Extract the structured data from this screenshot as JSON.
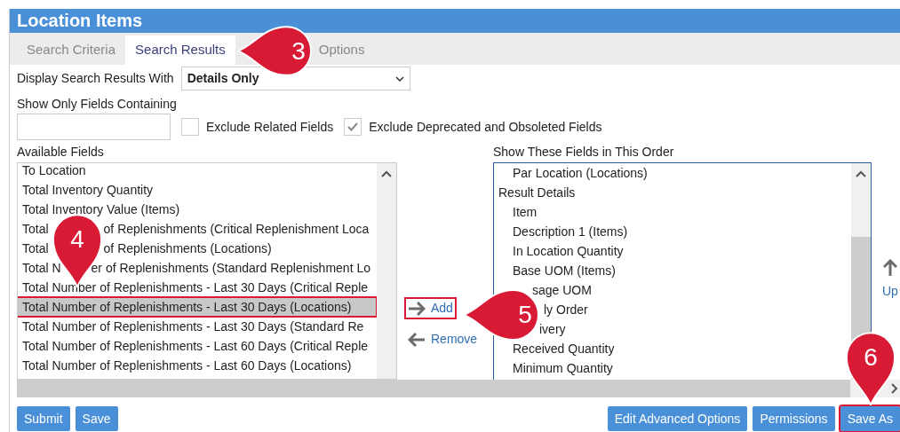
{
  "window": {
    "title": "Location Items"
  },
  "tabs": [
    {
      "label": "Search Criteria",
      "selected": false
    },
    {
      "label": "Search Results",
      "selected": true
    },
    {
      "label": "Options",
      "selected": false
    }
  ],
  "display_with": {
    "label": "Display Search Results With",
    "value": "Details Only"
  },
  "filter": {
    "label": "Show Only Fields Containing"
  },
  "checkboxes": [
    {
      "label": "Exclude Related Fields",
      "checked": false
    },
    {
      "label": "Exclude Deprecated and Obsoleted Fields",
      "checked": true
    }
  ],
  "available": {
    "label": "Available Fields",
    "items": [
      {
        "parts": [
          "To Location"
        ],
        "selected": false
      },
      {
        "parts": [
          "Total Inventory Quantity"
        ],
        "selected": false
      },
      {
        "parts": [
          "Total Inventory Value (Items)"
        ],
        "selected": false
      },
      {
        "parts": [
          "Total",
          "of Replenishments (Critical Replenishment Loca"
        ],
        "selected": false
      },
      {
        "parts": [
          "Total",
          "of Replenishments (Locations)"
        ],
        "selected": false
      },
      {
        "parts": [
          "Total N",
          "er of Replenishments (Standard Replenishment Lo"
        ],
        "selected": false
      },
      {
        "parts": [
          "Total Number of Replenishments - Last 30 Days (Critical Reple"
        ],
        "selected": false
      },
      {
        "parts": [
          "Total Number of Replenishments - Last 30 Days (Locations)"
        ],
        "selected": true
      },
      {
        "parts": [
          "Total Number of Replenishments - Last 30 Days (Standard Re"
        ],
        "selected": false
      },
      {
        "parts": [
          "Total Number of Replenishments - Last 60 Days (Critical Reple"
        ],
        "selected": false
      },
      {
        "parts": [
          "Total Number of Replenishments - Last 60 Days (Locations)"
        ],
        "selected": false
      }
    ]
  },
  "move_buttons": [
    {
      "label": "Add",
      "kind": "add"
    },
    {
      "label": "Remove",
      "kind": "remove"
    }
  ],
  "shown": {
    "label": "Show These Fields in This Order",
    "groups": [
      {
        "children": [
          {
            "label": "Par Location (Locations)"
          }
        ]
      },
      {
        "label": "Result Details",
        "children": [
          {
            "label": "Item"
          },
          {
            "label": "Description 1 (Items)"
          },
          {
            "label": "In Location Quantity"
          },
          {
            "label": "Base UOM (Items)"
          },
          {
            "label": "sage UOM"
          },
          {
            "label": "ly Order"
          },
          {
            "label": "ivery"
          },
          {
            "label": "Received Quantity"
          },
          {
            "label": "Minimum Quantity"
          }
        ]
      }
    ]
  },
  "order_buttons": [
    {
      "label": "Up"
    }
  ],
  "footer_left": [
    {
      "label": "Submit"
    },
    {
      "label": "Save"
    }
  ],
  "footer_right": [
    {
      "label": "Edit Advanced Options",
      "highlighted": false
    },
    {
      "label": "Permissions",
      "highlighted": false
    },
    {
      "label": "Save As",
      "highlighted": true
    }
  ],
  "callouts": [
    {
      "number": "3",
      "kind": "left"
    },
    {
      "number": "4",
      "kind": "down"
    },
    {
      "number": "5",
      "kind": "left"
    },
    {
      "number": "6",
      "kind": "down"
    }
  ]
}
